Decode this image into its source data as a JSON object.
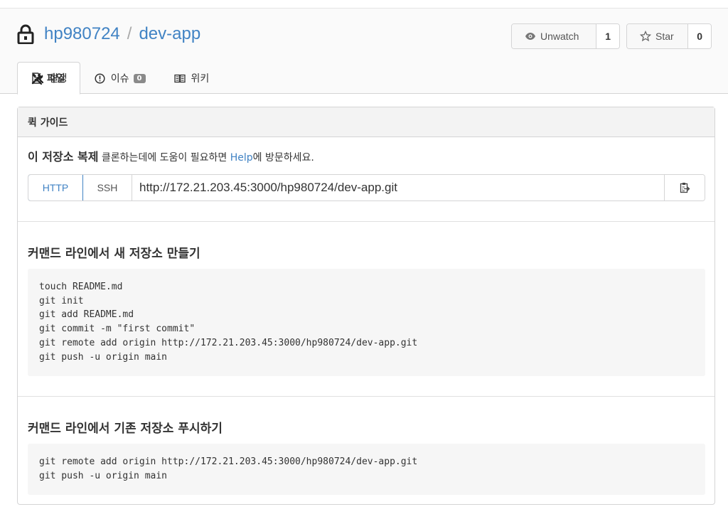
{
  "repo": {
    "owner": "hp980724",
    "separator": "/",
    "name": "dev-app"
  },
  "actions": {
    "watch_label": "Unwatch",
    "watch_count": "1",
    "star_label": "Star",
    "star_count": "0"
  },
  "tabs": {
    "files": "파일",
    "issues": "이슈",
    "issues_count": "0",
    "wiki": "위키",
    "settings": "설정"
  },
  "quick_guide": {
    "header": "퀵 가이드",
    "clone_title": "이 저장소 복제",
    "clone_desc_before": "클론하는데에 도움이 필요하면 ",
    "clone_help_link": "Help",
    "clone_desc_after": "에 방문하세요.",
    "http_label": "HTTP",
    "ssh_label": "SSH",
    "clone_url": "http://172.21.203.45:3000/hp980724/dev-app.git"
  },
  "new_repo": {
    "title": "커맨드 라인에서 새 저장소 만들기",
    "code": "touch README.md\ngit init\ngit add README.md\ngit commit -m \"first commit\"\ngit remote add origin http://172.21.203.45:3000/hp980724/dev-app.git\ngit push -u origin main"
  },
  "push_existing": {
    "title": "커맨드 라인에서 기존 저장소 푸시하기",
    "code": "git remote add origin http://172.21.203.45:3000/hp980724/dev-app.git\ngit push -u origin main"
  },
  "colors": {
    "link": "#4183c4",
    "header_bg": "#fafafa",
    "code_bg": "#f6f6f6"
  }
}
